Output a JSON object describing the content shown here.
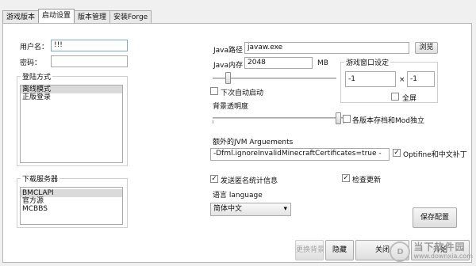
{
  "tabs": [
    "游戏版本",
    "启动设置",
    "版本管理",
    "安装Forge"
  ],
  "login": {
    "username_label": "用户名：",
    "username_value": "!!!",
    "password_label": "密码：",
    "mode_title": "登陆方式",
    "modes": [
      "离线模式",
      "正版登录"
    ]
  },
  "download": {
    "title": "下载服务器",
    "servers": [
      "BMCLAPI",
      "官方源",
      "MCBBS"
    ]
  },
  "java": {
    "path_label": "Java路径",
    "path_value": "javaw.exe",
    "browse": "浏览",
    "memory_label": "Java内存",
    "memory_value": "2048",
    "memory_unit": "MB",
    "memory_level": 0.12,
    "auto_start": "下次自动启动",
    "opacity_label": "背景透明度",
    "opacity_level": 0.95
  },
  "window": {
    "title": "游戏窗口设定",
    "width": "-1",
    "times": "×",
    "height": "-1",
    "fullscreen": "全屏"
  },
  "mod_independent": "各版本存档和Mod独立",
  "jvm": {
    "label": "额外的JVM Arguements",
    "value": "-Dfml.ignoreInvalidMinecraftCertificates=true -",
    "optifine": "Optifine和中文补丁"
  },
  "stats": "发送匿名统计信息",
  "check_update": "检查更新",
  "language": {
    "label": "语言 language",
    "value": "简体中文"
  },
  "buttons": {
    "save": "保存配置",
    "change_bg": "更换背景",
    "hide": "隐藏",
    "close": "关闭",
    "start": "开始"
  },
  "watermark": {
    "logo": "D",
    "main": "当下软件园",
    "sub": "www.downxia.com"
  },
  "colors": {
    "watermark": "#9b9b9b",
    "check": "#1a1a1a"
  },
  "icons": {
    "check": "✓",
    "dropdown": "▾"
  }
}
